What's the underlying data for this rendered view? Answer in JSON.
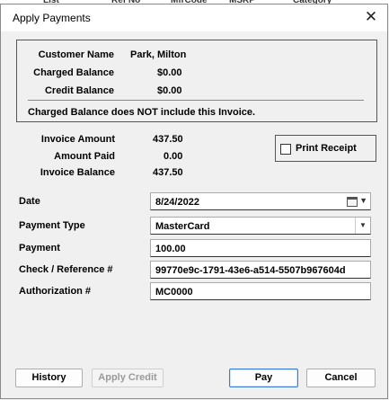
{
  "dialog": {
    "title": "Apply Payments",
    "close_icon": "close-icon"
  },
  "customer": {
    "name_label": "Customer Name",
    "name": "Park, Milton",
    "charged_label": "Charged Balance",
    "charged": "$0.00",
    "credit_label": "Credit Balance",
    "credit": "$0.00",
    "note": "Charged Balance does NOT include this Invoice."
  },
  "invoice": {
    "amount_label": "Invoice Amount",
    "amount": "437.50",
    "paid_label": "Amount Paid",
    "paid": "0.00",
    "balance_label": "Invoice Balance",
    "balance": "437.50"
  },
  "print_receipt": {
    "label": "Print Receipt",
    "checked": false
  },
  "form": {
    "date_label": "Date",
    "date": "8/24/2022",
    "payment_type_label": "Payment Type",
    "payment_type": "MasterCard",
    "payment_label": "Payment",
    "payment": "100.00",
    "check_ref_label": "Check / Reference #",
    "check_ref": "99770e9c-1791-43e6-a514-5507b967604d",
    "auth_label": "Authorization #",
    "auth": "MC0000"
  },
  "buttons": {
    "history": "History",
    "apply_credit": "Apply Credit",
    "pay": "Pay",
    "cancel": "Cancel"
  },
  "colors": {
    "accent": "#3a7bd5",
    "background": "#f0f0f0"
  }
}
